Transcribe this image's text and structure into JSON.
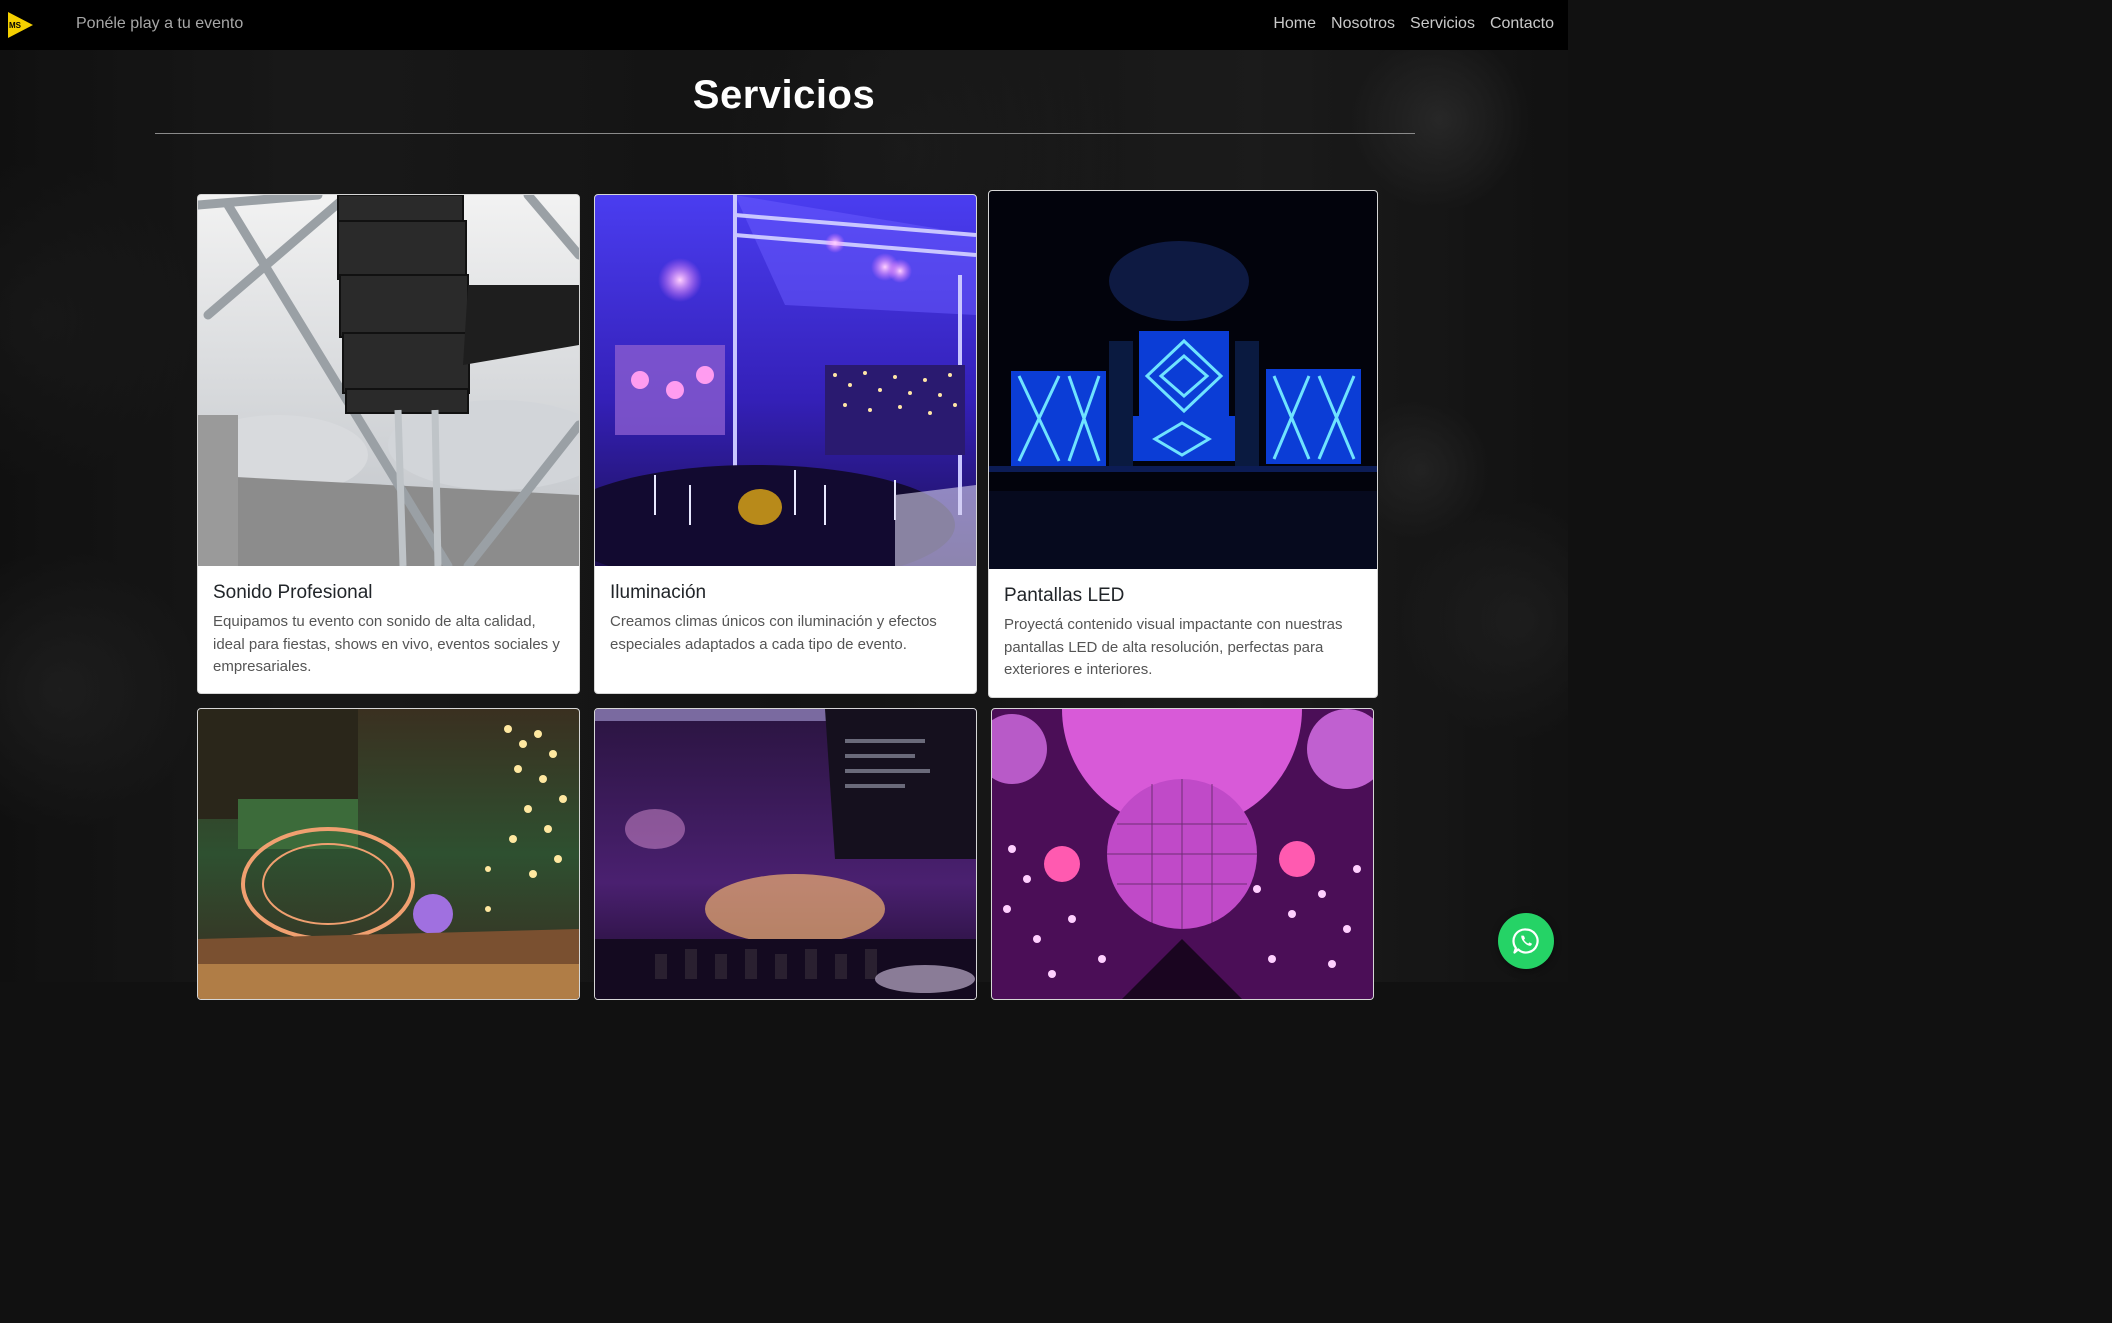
{
  "navbar": {
    "logo_icon": "play-triangle-logo",
    "tagline": "Ponéle play a tu evento",
    "links": [
      "Home",
      "Nosotros",
      "Servicios",
      "Contacto"
    ]
  },
  "section": {
    "title": "Servicios"
  },
  "cards": [
    {
      "title": "Sonido Profesional",
      "text": "Equipamos tu evento con sonido de alta calidad, ideal para fiestas, shows en vivo, eventos sociales y empresariales."
    },
    {
      "title": "Iluminación",
      "text": "Creamos climas únicos con iluminación y efectos especiales adaptados a cada tipo de evento."
    },
    {
      "title": "Pantallas LED",
      "text": "Proyectá contenido visual impactante con nuestras pantallas LED de alta resolución, perfectas para exteriores e interiores."
    }
  ],
  "floating": {
    "whatsapp_icon": "whatsapp-icon",
    "whatsapp_color": "#25d366"
  },
  "colors": {
    "navbar_bg": "#000000",
    "logo_yellow": "#f5d000"
  }
}
